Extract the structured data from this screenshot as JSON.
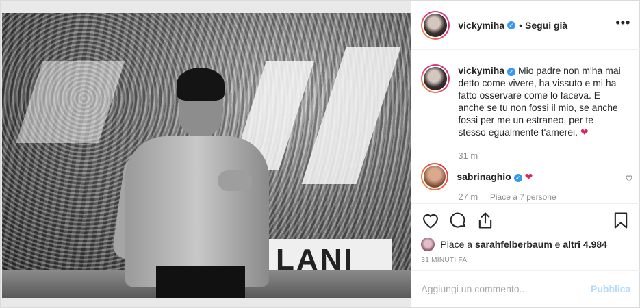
{
  "header": {
    "username": "vickymiha",
    "separator": "•",
    "follow_status": "Segui già",
    "more": "•••"
  },
  "caption": {
    "username": "vickymiha",
    "text": "Mio padre non m'ha mai detto come vivere, ha vissuto e mi ha fatto osservare come lo faceva. E anche se tu non fossi il mio, se anche fossi per me un estraneo, per te stesso egualmente t'amerei.",
    "emoji": "❤",
    "time": "31 m"
  },
  "comment": {
    "username": "sabrinaghio",
    "emoji": "❤",
    "time": "27 m",
    "likes": "Piace a 7 persone"
  },
  "photo": {
    "board_text": "LANI"
  },
  "likes": {
    "prefix": "Piace a ",
    "user": "sarahfelberbaum",
    "middle": " e ",
    "others": "altri 4.984"
  },
  "timestamp": "31 minuti fa",
  "add_comment": {
    "placeholder": "Aggiungi un commento...",
    "publish": "Pubblica"
  },
  "icons": [
    "heart-icon",
    "comment-icon",
    "share-icon",
    "bookmark-icon",
    "verified-icon",
    "more-icon"
  ],
  "colors": {
    "verified": "#3897f0",
    "heart": "#e0245e",
    "publish": "#b3dbff"
  }
}
